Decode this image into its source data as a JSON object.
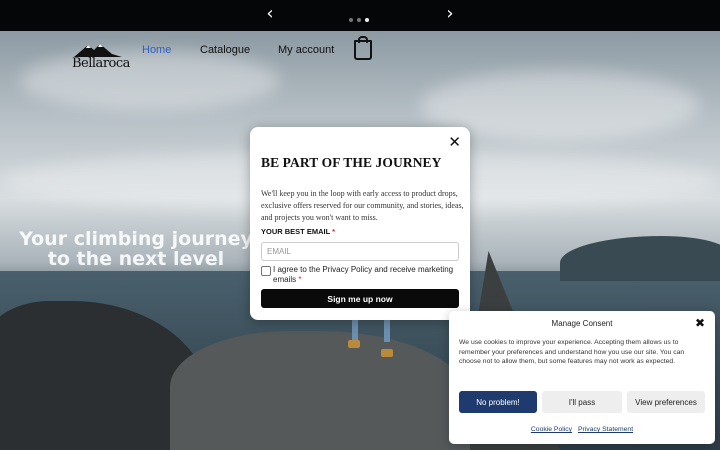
{
  "carousel": {
    "prev_icon": "chevron-left-icon",
    "next_icon": "chevron-right-icon",
    "slide_count": 3,
    "active_slide": 3
  },
  "nav": {
    "logo_text": "Bellaroca",
    "items": [
      {
        "label": "Home",
        "active": true
      },
      {
        "label": "Catalogue",
        "active": false
      },
      {
        "label": "My account",
        "active": false
      }
    ],
    "cart_icon": "shopping-bag-icon"
  },
  "hero": {
    "title_line1": "Your climbing journey",
    "title_line2": "to the next level"
  },
  "newsletter": {
    "title": "BE PART OF THE JOURNEY",
    "description": "We'll keep you in the loop with early access to product drops, exclusive offers reserved for our community, and stories, ideas, and projects you won't want to miss.",
    "email_label": "YOUR BEST EMAIL",
    "required_mark": "*",
    "email_placeholder": "EMAIL",
    "consent_label": "I agree to the Privacy Policy and receive marketing emails",
    "submit_label": "Sign me up now",
    "close_icon": "close-icon"
  },
  "cookie_consent": {
    "title": "Manage Consent",
    "description": "We use cookies to improve your experience. Accepting them allows us to remember your preferences and understand how you use our site. You can choose not to allow them, but some features may not work as expected.",
    "accept_label": "No problem!",
    "deny_label": "I'll pass",
    "preferences_label": "View preferences",
    "cookie_policy_link": "Cookie Policy",
    "privacy_link": "Privacy Statement",
    "close_icon": "close-icon"
  },
  "colors": {
    "nav_active": "#2f5fbf",
    "accept_button": "#1e3a6e",
    "signup_button": "#0a0a0a"
  }
}
